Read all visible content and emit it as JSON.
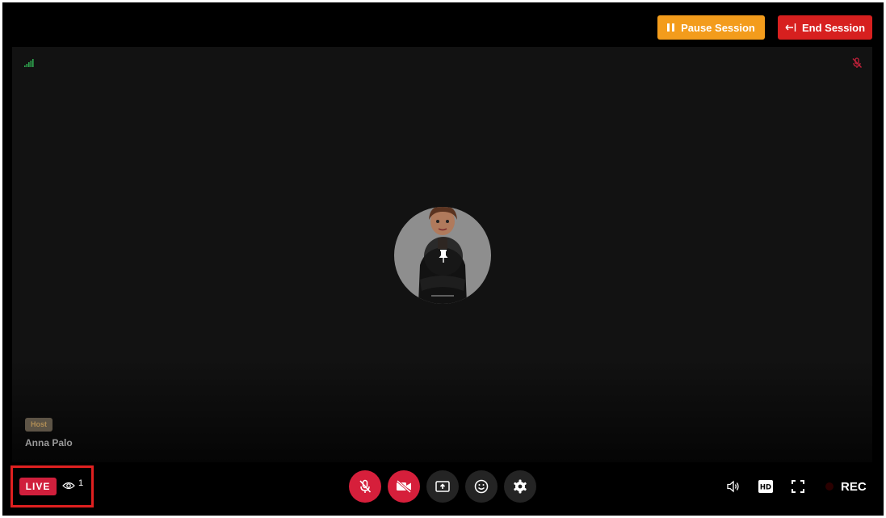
{
  "header": {
    "pause_label": "Pause Session",
    "end_label": "End Session"
  },
  "stage": {
    "participant": {
      "role_badge": "Host",
      "name": "Anna Palo"
    }
  },
  "footer": {
    "live_label": "LIVE",
    "viewer_count": "1",
    "rec_label": "REC",
    "hd_label": "HD"
  },
  "colors": {
    "pause": "#f39c1c",
    "end": "#d7201f",
    "live": "#d01f3c",
    "highlight": "#e02020"
  },
  "icons": {
    "signal": "signal-bars-icon",
    "remote_mic": "mic-muted-icon",
    "pin": "pin-icon",
    "mic": "mic-muted-icon",
    "camera": "camera-off-icon",
    "share": "share-screen-icon",
    "reactions": "smiley-icon",
    "settings": "gear-icon",
    "volume": "speaker-icon",
    "quality": "hd-icon",
    "fullscreen": "fullscreen-icon",
    "record": "record-dot-icon"
  }
}
